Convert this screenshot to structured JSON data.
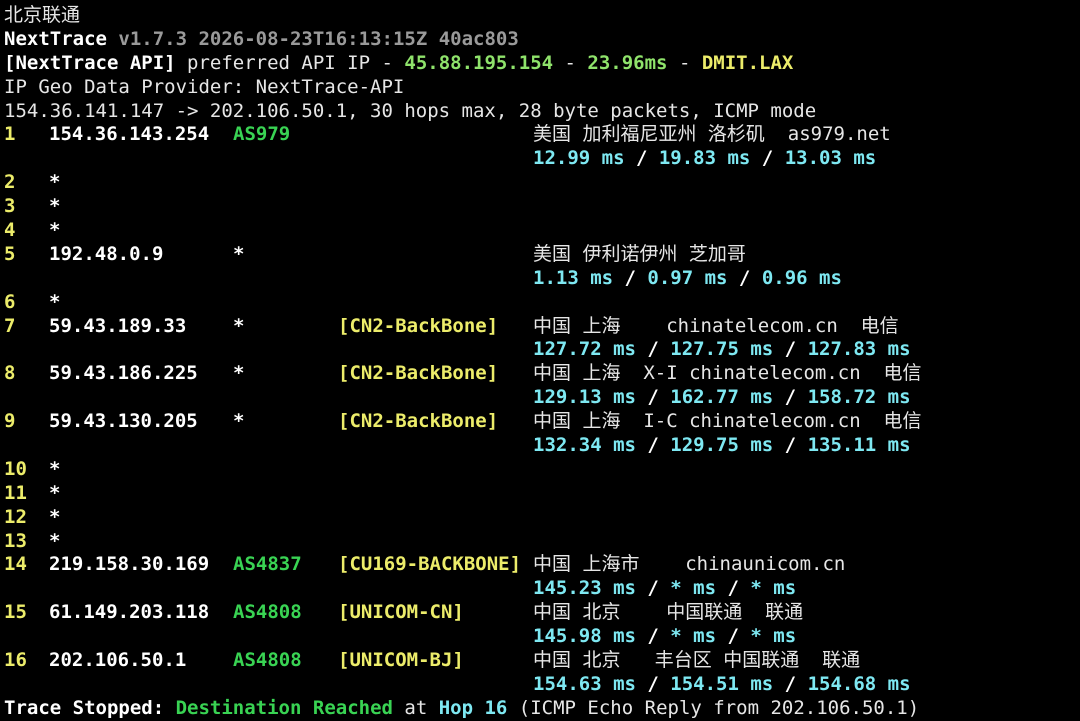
{
  "header": {
    "title": "北京联通",
    "app": "NextTrace",
    "version": "v1.7.3 2026-08-23T16:13:15Z 40ac803",
    "api_prefix": "[NextTrace API]",
    "api_text": " preferred API IP - ",
    "api_ip": "45.88.195.154",
    "sep1": " - ",
    "api_latency": "23.96ms",
    "sep2": " - ",
    "api_node": "DMIT.LAX",
    "geo_provider": "IP Geo Data Provider: NextTrace-API",
    "trace_info": "154.36.141.147 -> 202.106.50.1, 30 hops max, 28 byte packets, ICMP mode"
  },
  "hops": [
    {
      "n": "1",
      "ip": "154.36.143.254",
      "asn": "AS979",
      "tag": "",
      "geo": "美国 加利福尼亚州 洛杉矶  as979.net",
      "rtt": [
        "12.99 ms",
        "19.83 ms",
        "13.03 ms"
      ]
    },
    {
      "n": "2",
      "ip": "*"
    },
    {
      "n": "3",
      "ip": "*"
    },
    {
      "n": "4",
      "ip": "*"
    },
    {
      "n": "5",
      "ip": "192.48.0.9",
      "asn": "*",
      "tag": "",
      "geo": "美国 伊利诺伊州 芝加哥",
      "rtt": [
        "1.13 ms",
        "0.97 ms",
        "0.96 ms"
      ]
    },
    {
      "n": "6",
      "ip": "*"
    },
    {
      "n": "7",
      "ip": "59.43.189.33",
      "asn": "*",
      "tag": "[CN2-BackBone]",
      "geo": "中国 上海    chinatelecom.cn  电信",
      "rtt": [
        "127.72 ms",
        "127.75 ms",
        "127.83 ms"
      ]
    },
    {
      "n": "8",
      "ip": "59.43.186.225",
      "asn": "*",
      "tag": "[CN2-BackBone]",
      "geo": "中国 上海  X-I chinatelecom.cn  电信",
      "rtt": [
        "129.13 ms",
        "162.77 ms",
        "158.72 ms"
      ]
    },
    {
      "n": "9",
      "ip": "59.43.130.205",
      "asn": "*",
      "tag": "[CN2-BackBone]",
      "geo": "中国 上海  I-C chinatelecom.cn  电信",
      "rtt": [
        "132.34 ms",
        "129.75 ms",
        "135.11 ms"
      ]
    },
    {
      "n": "10",
      "ip": "*"
    },
    {
      "n": "11",
      "ip": "*"
    },
    {
      "n": "12",
      "ip": "*"
    },
    {
      "n": "13",
      "ip": "*"
    },
    {
      "n": "14",
      "ip": "219.158.30.169",
      "asn": "AS4837",
      "tag": "[CU169-BACKBONE]",
      "geo": "中国 上海市    chinaunicom.cn",
      "rtt": [
        "145.23 ms",
        "* ms",
        "* ms"
      ]
    },
    {
      "n": "15",
      "ip": "61.149.203.118",
      "asn": "AS4808",
      "tag": "[UNICOM-CN]",
      "geo": "中国 北京    中国联通  联通",
      "rtt": [
        "145.98 ms",
        "* ms",
        "* ms"
      ]
    },
    {
      "n": "16",
      "ip": "202.106.50.1",
      "asn": "AS4808",
      "tag": "[UNICOM-BJ]",
      "geo": "中国 北京   丰台区 中国联通  联通",
      "rtt": [
        "154.63 ms",
        "154.51 ms",
        "154.68 ms"
      ]
    }
  ],
  "footer": {
    "label": "Trace Stopped:",
    "status": "Destination Reached",
    "at": " at ",
    "hop": "Hop 16",
    "detail": " (ICMP Echo Reply from 202.106.50.1)"
  },
  "colors": {
    "background": "#000000",
    "ip": "#ffffff",
    "asn": "#39d353",
    "tag": "#ecec6a",
    "rtt": "#7ee8f2",
    "hop": "#ecec6a"
  }
}
